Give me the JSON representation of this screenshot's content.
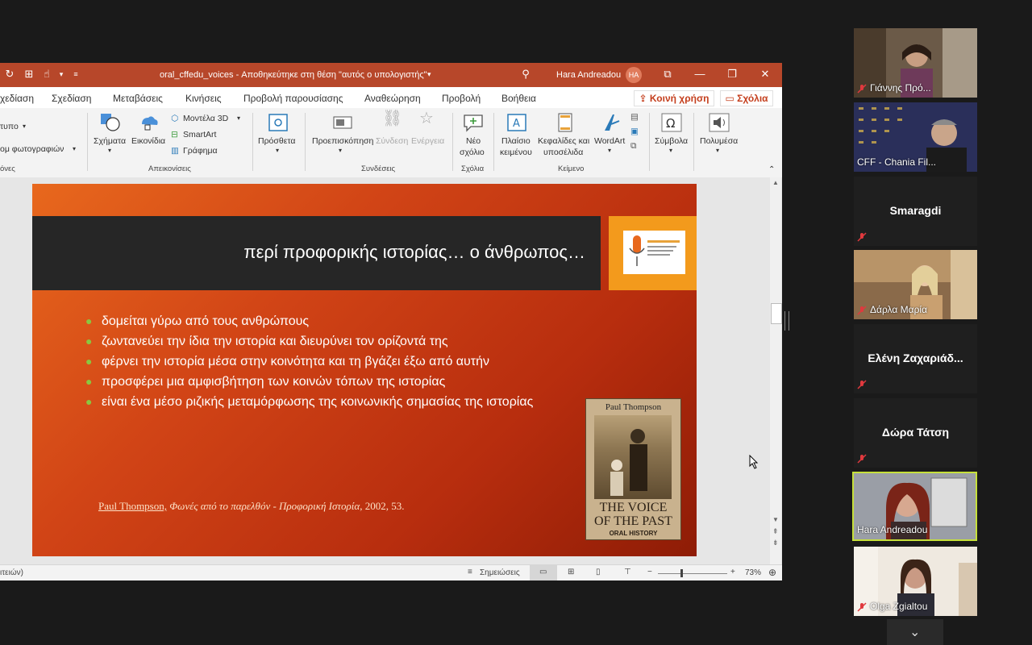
{
  "window": {
    "title": "oral_cffedu_voices  -  Αποθηκεύτηκε στη θέση \"αυτός ο υπολογιστής\"",
    "user": "Hara Andreadou",
    "user_initials": "HA"
  },
  "tabs": [
    "χεδίαση",
    "Σχεδίαση",
    "Μεταβάσεις",
    "Κινήσεις",
    "Προβολή παρουσίασης",
    "Αναθεώρηση",
    "Προβολή",
    "Βοήθεια"
  ],
  "share_label": "Κοινή χρήση",
  "comments_label": "Σχόλια",
  "ribbon": {
    "left_partial": [
      "τυπο",
      "ομ φωτογραφιών",
      "όνες"
    ],
    "shapes": "Σχήματα",
    "icons": "Εικονίδια",
    "models3d": "Μοντέλα 3D",
    "smartart": "SmartArt",
    "chart": "Γράφημα",
    "group_illustrations": "Απεικονίσεις",
    "addins": "Πρόσθετα",
    "zoom": "Προεπισκόπηση",
    "link": "Σύνδεση",
    "action": "Ενέργεια",
    "group_links": "Συνδέσεις",
    "new_comment_1": "Νέο",
    "new_comment_2": "σχόλιο",
    "group_comments": "Σχόλια",
    "textbox_1": "Πλαίσιο",
    "textbox_2": "κειμένου",
    "headerfooter_1": "Κεφαλίδες και",
    "headerfooter_2": "υποσέλιδα",
    "wordart": "WordArt",
    "group_text": "Κείμενο",
    "symbols": "Σύμβολα",
    "media": "Πολυμέσα"
  },
  "slide": {
    "title": "περί προφορικής ιστορίας… ο άνθρωπος…",
    "bullets": [
      "δομείται γύρω από τους ανθρώπους",
      "ζωντανεύει την ίδια την ιστορία και διευρύνει τον ορίζοντά της",
      "φέρνει την ιστορία μέσα στην κοινότητα και τη βγάζει έξω από αυτήν",
      "προσφέρει μια αμφισβήτηση των κοινών τόπων της ιστορίας",
      "είναι ένα μέσο ριζικής μεταμόρφωσης της κοινωνικής σημασίας της ιστορίας"
    ],
    "citation_author": "Paul Thompson,",
    "citation_title": "Φωνές από το παρελθόν - Προφορική Ιστορία",
    "citation_rest": ", 2002, 53.",
    "book_author": "Paul Thompson",
    "book_title_1": "THE VOICE",
    "book_title_2": "OF THE PAST",
    "book_subtitle": "ORAL HISTORY",
    "logo_text": "ΦΩΝΕΣ"
  },
  "status": {
    "left_partial": "ιτειών)",
    "notes": "Σημειώσεις",
    "zoom": "73%"
  },
  "participants": [
    {
      "name": "Γιάννης Πρό...",
      "video": true
    },
    {
      "name": "CFF - Chania Fil...",
      "video": true
    },
    {
      "name": "Smaragdi",
      "video": false
    },
    {
      "name": "Δάρλα Μαρία",
      "video": true
    },
    {
      "name": "Ελένη Ζαχαριάδ...",
      "video": false
    },
    {
      "name": "Δώρα Τάτση",
      "video": false
    },
    {
      "name": "Hara Andreadou",
      "video": true,
      "active": true
    },
    {
      "name": "Olga Zgialtou",
      "video": true
    }
  ],
  "colors": {
    "ppt_accent": "#b7472a",
    "slide_orange": "#e8681d",
    "slide_red": "#8e1c06",
    "bullet_green": "#8cc63f",
    "active_speaker": "#c6e03a",
    "muted_mic": "#e0393e"
  }
}
